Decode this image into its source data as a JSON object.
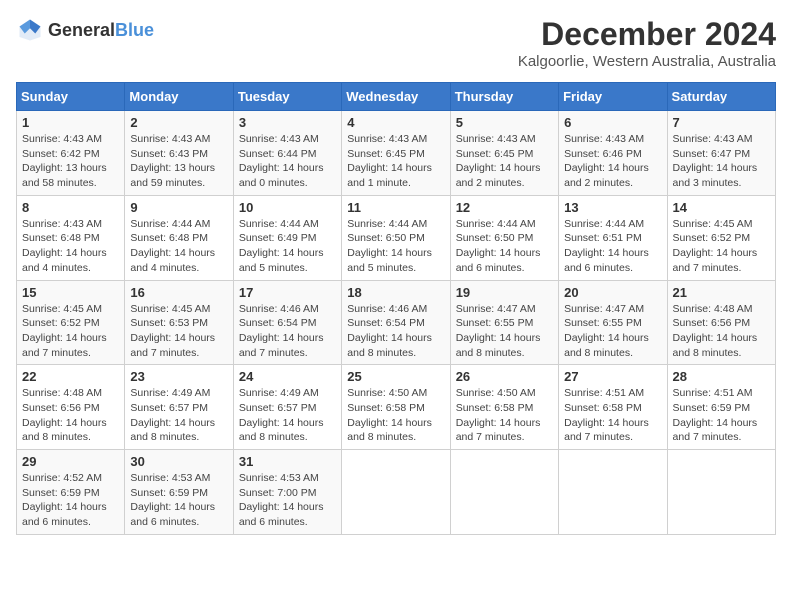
{
  "header": {
    "logo_general": "General",
    "logo_blue": "Blue",
    "title": "December 2024",
    "subtitle": "Kalgoorlie, Western Australia, Australia"
  },
  "calendar": {
    "columns": [
      "Sunday",
      "Monday",
      "Tuesday",
      "Wednesday",
      "Thursday",
      "Friday",
      "Saturday"
    ],
    "weeks": [
      [
        {
          "day": "",
          "info": ""
        },
        {
          "day": "2",
          "info": "Sunrise: 4:43 AM\nSunset: 6:43 PM\nDaylight: 13 hours\nand 59 minutes."
        },
        {
          "day": "3",
          "info": "Sunrise: 4:43 AM\nSunset: 6:44 PM\nDaylight: 14 hours\nand 0 minutes."
        },
        {
          "day": "4",
          "info": "Sunrise: 4:43 AM\nSunset: 6:45 PM\nDaylight: 14 hours\nand 1 minute."
        },
        {
          "day": "5",
          "info": "Sunrise: 4:43 AM\nSunset: 6:45 PM\nDaylight: 14 hours\nand 2 minutes."
        },
        {
          "day": "6",
          "info": "Sunrise: 4:43 AM\nSunset: 6:46 PM\nDaylight: 14 hours\nand 2 minutes."
        },
        {
          "day": "7",
          "info": "Sunrise: 4:43 AM\nSunset: 6:47 PM\nDaylight: 14 hours\nand 3 minutes."
        }
      ],
      [
        {
          "day": "1",
          "info": "Sunrise: 4:43 AM\nSunset: 6:42 PM\nDaylight: 13 hours\nand 58 minutes."
        },
        {
          "day": "",
          "info": ""
        },
        {
          "day": "",
          "info": ""
        },
        {
          "day": "",
          "info": ""
        },
        {
          "day": "",
          "info": ""
        },
        {
          "day": "",
          "info": ""
        },
        {
          "day": "",
          "info": ""
        }
      ],
      [
        {
          "day": "8",
          "info": "Sunrise: 4:43 AM\nSunset: 6:48 PM\nDaylight: 14 hours\nand 4 minutes."
        },
        {
          "day": "9",
          "info": "Sunrise: 4:44 AM\nSunset: 6:48 PM\nDaylight: 14 hours\nand 4 minutes."
        },
        {
          "day": "10",
          "info": "Sunrise: 4:44 AM\nSunset: 6:49 PM\nDaylight: 14 hours\nand 5 minutes."
        },
        {
          "day": "11",
          "info": "Sunrise: 4:44 AM\nSunset: 6:50 PM\nDaylight: 14 hours\nand 5 minutes."
        },
        {
          "day": "12",
          "info": "Sunrise: 4:44 AM\nSunset: 6:50 PM\nDaylight: 14 hours\nand 6 minutes."
        },
        {
          "day": "13",
          "info": "Sunrise: 4:44 AM\nSunset: 6:51 PM\nDaylight: 14 hours\nand 6 minutes."
        },
        {
          "day": "14",
          "info": "Sunrise: 4:45 AM\nSunset: 6:52 PM\nDaylight: 14 hours\nand 7 minutes."
        }
      ],
      [
        {
          "day": "15",
          "info": "Sunrise: 4:45 AM\nSunset: 6:52 PM\nDaylight: 14 hours\nand 7 minutes."
        },
        {
          "day": "16",
          "info": "Sunrise: 4:45 AM\nSunset: 6:53 PM\nDaylight: 14 hours\nand 7 minutes."
        },
        {
          "day": "17",
          "info": "Sunrise: 4:46 AM\nSunset: 6:54 PM\nDaylight: 14 hours\nand 7 minutes."
        },
        {
          "day": "18",
          "info": "Sunrise: 4:46 AM\nSunset: 6:54 PM\nDaylight: 14 hours\nand 8 minutes."
        },
        {
          "day": "19",
          "info": "Sunrise: 4:47 AM\nSunset: 6:55 PM\nDaylight: 14 hours\nand 8 minutes."
        },
        {
          "day": "20",
          "info": "Sunrise: 4:47 AM\nSunset: 6:55 PM\nDaylight: 14 hours\nand 8 minutes."
        },
        {
          "day": "21",
          "info": "Sunrise: 4:48 AM\nSunset: 6:56 PM\nDaylight: 14 hours\nand 8 minutes."
        }
      ],
      [
        {
          "day": "22",
          "info": "Sunrise: 4:48 AM\nSunset: 6:56 PM\nDaylight: 14 hours\nand 8 minutes."
        },
        {
          "day": "23",
          "info": "Sunrise: 4:49 AM\nSunset: 6:57 PM\nDaylight: 14 hours\nand 8 minutes."
        },
        {
          "day": "24",
          "info": "Sunrise: 4:49 AM\nSunset: 6:57 PM\nDaylight: 14 hours\nand 8 minutes."
        },
        {
          "day": "25",
          "info": "Sunrise: 4:50 AM\nSunset: 6:58 PM\nDaylight: 14 hours\nand 8 minutes."
        },
        {
          "day": "26",
          "info": "Sunrise: 4:50 AM\nSunset: 6:58 PM\nDaylight: 14 hours\nand 7 minutes."
        },
        {
          "day": "27",
          "info": "Sunrise: 4:51 AM\nSunset: 6:58 PM\nDaylight: 14 hours\nand 7 minutes."
        },
        {
          "day": "28",
          "info": "Sunrise: 4:51 AM\nSunset: 6:59 PM\nDaylight: 14 hours\nand 7 minutes."
        }
      ],
      [
        {
          "day": "29",
          "info": "Sunrise: 4:52 AM\nSunset: 6:59 PM\nDaylight: 14 hours\nand 6 minutes."
        },
        {
          "day": "30",
          "info": "Sunrise: 4:53 AM\nSunset: 6:59 PM\nDaylight: 14 hours\nand 6 minutes."
        },
        {
          "day": "31",
          "info": "Sunrise: 4:53 AM\nSunset: 7:00 PM\nDaylight: 14 hours\nand 6 minutes."
        },
        {
          "day": "",
          "info": ""
        },
        {
          "day": "",
          "info": ""
        },
        {
          "day": "",
          "info": ""
        },
        {
          "day": "",
          "info": ""
        }
      ]
    ]
  }
}
